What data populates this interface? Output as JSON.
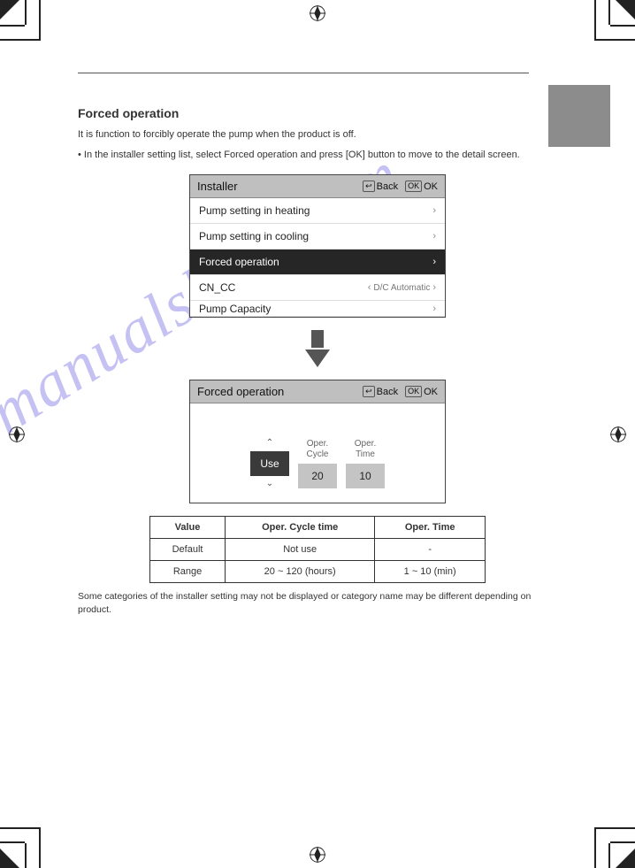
{
  "section": {
    "title": "Forced operation",
    "desc": "It is function to forcibly operate the pump when the product is off.",
    "step": "In the installer setting list, select Forced operation and press [OK] button to move to the detail screen."
  },
  "lcd1": {
    "title": "Installer",
    "back": "Back",
    "ok": "OK",
    "rows": [
      {
        "label": "Pump setting in heating",
        "right": "›"
      },
      {
        "label": "Pump setting in cooling",
        "right": "›"
      },
      {
        "label": "Forced operation",
        "right": "›",
        "selected": true
      },
      {
        "label": "CN_CC",
        "right_val": "D/C Automatic"
      },
      {
        "label": "Pump Capacity",
        "right": "›"
      }
    ]
  },
  "lcd2": {
    "title": "Forced operation",
    "back": "Back",
    "ok": "OK",
    "col0_label": "",
    "col1_label": "Oper.\nCycle",
    "col2_label": "Oper.\nTime",
    "val0": "Use",
    "val1": "20",
    "val2": "10"
  },
  "table": {
    "h1": "Value",
    "h2": "Oper. Cycle time",
    "h3": "Oper. Time",
    "r1c1": "Default",
    "r1c2": "Not use",
    "r1c3": "-",
    "r2c1": "Range",
    "r2c2": "20 ~ 120 (hours)",
    "r2c3": "1 ~ 10 (min)"
  },
  "watermark": "manualshive.com",
  "note": "Some categories of the installer setting may not be displayed or category name may be different depending on product."
}
